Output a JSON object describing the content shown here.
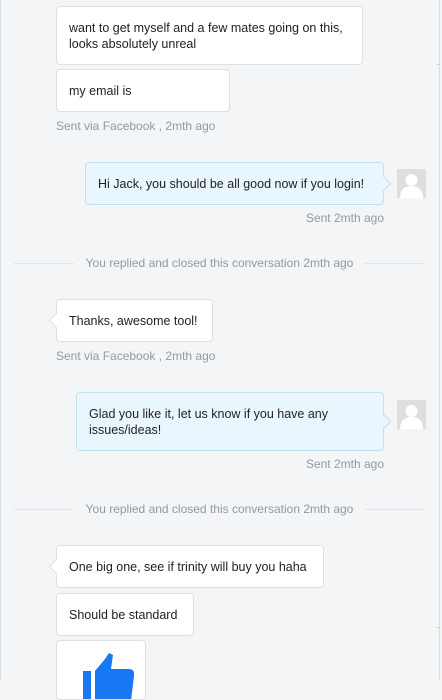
{
  "conversation": {
    "messages": [
      {
        "from": "customer",
        "text": "want to get myself and a few mates going on this, looks absolutely unreal"
      },
      {
        "from": "customer",
        "text": "my email is"
      },
      {
        "from": "customer_meta",
        "text": "Sent via Facebook , 2mth ago"
      },
      {
        "from": "agent",
        "text": "Hi Jack, you should be all good now if you login!"
      },
      {
        "from": "agent_meta",
        "text": "Sent 2mth ago"
      },
      {
        "from": "system",
        "text": "You replied and closed this conversation 2mth ago"
      },
      {
        "from": "customer",
        "text": "Thanks, awesome tool!"
      },
      {
        "from": "customer_meta",
        "text": "Sent via Facebook , 2mth ago"
      },
      {
        "from": "agent",
        "text": "Glad you like it, let us know if you have any issues/ideas!"
      },
      {
        "from": "agent_meta",
        "text": "Sent 2mth ago"
      },
      {
        "from": "system",
        "text": "You replied and closed this conversation 2mth ago"
      },
      {
        "from": "customer",
        "text": "One big one, see if trinity will buy you haha"
      },
      {
        "from": "customer",
        "text": "Should be standard"
      },
      {
        "from": "customer",
        "attachment": "thumbs-up-sticker"
      }
    ]
  },
  "colors": {
    "page_bg": "#f4f5f6",
    "agent_bubble": "#eaf6fd",
    "customer_bubble": "#ffffff",
    "meta_text": "#8f9aa3",
    "thumb_blue": "#1877f2"
  },
  "icons": {
    "avatar": "default-user-avatar-icon",
    "sticker": "thumbs-up-icon"
  }
}
